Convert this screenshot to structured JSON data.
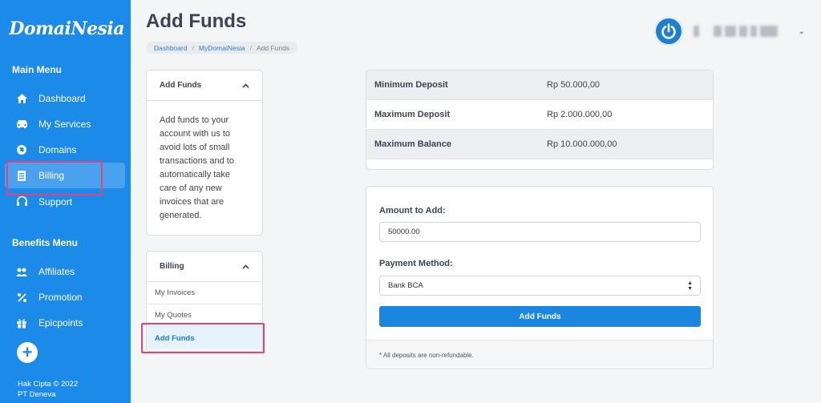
{
  "brand": {
    "name": "DomaiNesia"
  },
  "sidebar": {
    "main_heading": "Main Menu",
    "main_items": [
      {
        "label": "Dashboard",
        "icon": "home-icon"
      },
      {
        "label": "My Services",
        "icon": "car-icon"
      },
      {
        "label": "Domains",
        "icon": "globe-icon"
      },
      {
        "label": "Billing",
        "icon": "invoice-icon"
      },
      {
        "label": "Support",
        "icon": "headset-icon"
      }
    ],
    "benefits_heading": "Benefits Menu",
    "benefit_items": [
      {
        "label": "Affiliates",
        "icon": "users-icon"
      },
      {
        "label": "Promotion",
        "icon": "percent-icon"
      },
      {
        "label": "Epicpoints",
        "icon": "gift-icon"
      }
    ],
    "plus_label": "+",
    "copyright_line1": "Hak Cipta © 2022",
    "copyright_line2": "PT Deneva"
  },
  "header": {
    "title": "Add Funds",
    "breadcrumb": [
      "Dashboard",
      "MyDomaiNesia",
      "Add Funds"
    ],
    "separator": "/",
    "caret": "⌄"
  },
  "info_panel": {
    "title": "Add Funds",
    "body": "Add funds to your account with us to avoid lots of small transactions and to automatically take care of any new invoices that are generated."
  },
  "billing_panel": {
    "title": "Billing",
    "items": [
      "My Invoices",
      "My Quotes",
      "Add Funds"
    ]
  },
  "limits": {
    "rows": [
      {
        "label": "Minimum Deposit",
        "value": "Rp 50.000,00"
      },
      {
        "label": "Maximum Deposit",
        "value": "Rp 2.000.000,00"
      },
      {
        "label": "Maximum Balance",
        "value": "Rp 10.000.000,00"
      }
    ]
  },
  "form": {
    "amount_label": "Amount to Add:",
    "amount_value": "50000.00",
    "method_label": "Payment Method:",
    "method_value": "Bank BCA",
    "submit_label": "Add Funds",
    "footnote": "* All deposits are non-refundable."
  },
  "colors": {
    "sidebar": "#1c8ae8",
    "primary_button": "#1a86e0",
    "highlight": "#e5427a"
  }
}
